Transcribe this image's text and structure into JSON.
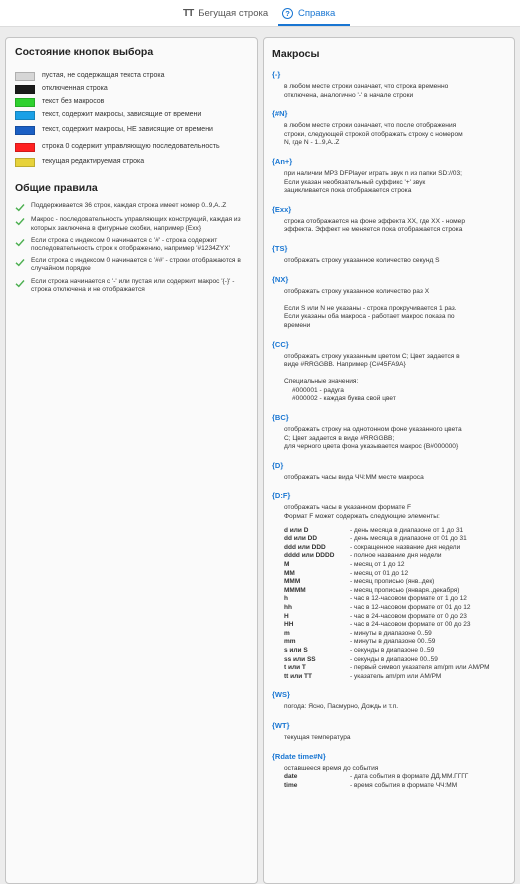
{
  "tabs": [
    {
      "label": "Бегущая строка",
      "icon": "text-format-icon",
      "icon_glyph": "TT",
      "active": false
    },
    {
      "label": "Справка",
      "icon": "help-circle-icon",
      "icon_glyph": "?",
      "active": true
    }
  ],
  "colors": {
    "accent": "#1976d2",
    "check": "#4caf50"
  },
  "left": {
    "title": "Состояние кнопок выбора",
    "legend": [
      {
        "color": "#d6d6d6",
        "text": "пустая, не содержащая текста строка"
      },
      {
        "color": "#1b1b1b",
        "text": "отключенная строка"
      },
      {
        "color": "#2fd12f",
        "text": "текст без макросов"
      },
      {
        "color": "#1aa0e6",
        "text": "текст, содержит макросы, зависящие от времени"
      },
      {
        "color": "#1a5fc4",
        "text": "текст, содержит макросы, НЕ зависящие от времени"
      },
      {
        "color": "#ff2020",
        "text": "строка 0 содержит управляющую последовательность"
      },
      {
        "color": "#e7d23a",
        "text": "текущая редактируемая строка"
      }
    ],
    "rules_title": "Общие правила",
    "rules": [
      "Поддерживается 36 строк, каждая строка имеет номер 0..9,A..Z",
      "Макрос - последовательность управляющих конструкций, каждая из которых заключена в фигурные скобки, например {Exx}",
      "Если строка с индексом 0 начинается с '#' - строка содержит последовательность строк к отображению, например '#1234ZYX'",
      "Если строка с индексом 0 начинается с '##' - строки отображаются в случайном порядке",
      "Если строка начинается с '-' или пустая или содержит макрос '{-}' - строка отключена и не отображается"
    ]
  },
  "right": {
    "title": "Макросы",
    "macros": [
      {
        "code": "{-}",
        "lines": [
          "в любом месте строки означает, что строка временно",
          "отключена, аналогично '-' в начале строки"
        ]
      },
      {
        "code": "{#N}",
        "lines": [
          "в любом месте строки означает, что после отображения",
          "строки, следующей строкой отображать строку с номером",
          "N, где N - 1..9,A..Z"
        ]
      },
      {
        "code": "{An+}",
        "lines": [
          "при наличии MP3 DFPlayer играть звук n из папки SD://03;",
          "Если указан необязательный суффикс '+' звук",
          "зацикливается пока отображается строка"
        ]
      },
      {
        "code": "{Exx}",
        "lines": [
          "строка отображается на фоне эффекта XX, где XX - номер",
          "эффекта. Эффект не меняется пока отображается строка"
        ]
      },
      {
        "code": "{TS}",
        "lines": [
          "отображать строку указанное количество секунд S"
        ]
      },
      {
        "code": "{NX}",
        "lines": [
          "отображать строку указанное количество раз X",
          "",
          "Если S или N не указаны - строка прокручивается 1 раз.",
          "Если указаны оба макроса - работает макрос показа по",
          "времени"
        ]
      },
      {
        "code": "{CC}",
        "lines": [
          "отображать строку указанным цветом C; Цвет задается в",
          "виде #RRGGBB. Например {C#45FA9A}",
          "",
          "Специальные значения:",
          "  #000001 - радуга",
          "  #000002 - каждая буква свой цвет"
        ]
      },
      {
        "code": "{BC}",
        "lines": [
          "отображать строку на однотонном фоне указанного цвета",
          "C; Цвет задается в виде #RRGGBB;",
          "для черного цвета фона указывается макрос {B#000000}"
        ]
      },
      {
        "code": "{D}",
        "lines": [
          "отображать часы вида ЧЧ:ММ месте макроса"
        ]
      },
      {
        "code": "{D:F}",
        "lines": [
          "отображать часы в указанном формате F",
          "Формат F может содержать следующие элементы:"
        ]
      }
    ],
    "formats": [
      {
        "key": "d или D",
        "val": "- день месяца в диапазоне от 1 до 31"
      },
      {
        "key": "dd или DD",
        "val": "- день месяца в диапазоне от 01 до 31"
      },
      {
        "key": "ddd или DDD",
        "val": "- сокращенное название дня недели"
      },
      {
        "key": "dddd или DDDD",
        "val": "- полное название дня недели"
      },
      {
        "key": "M",
        "val": "- месяц от 1 до 12"
      },
      {
        "key": "MM",
        "val": "- месяц от 01 до 12"
      },
      {
        "key": "MMM",
        "val": "- месяц прописью (янв..дек)"
      },
      {
        "key": "MMMM",
        "val": "- месяц прописью (января..декабря)"
      },
      {
        "key": "h",
        "val": "- час в 12-часовом формате от 1 до 12"
      },
      {
        "key": "hh",
        "val": "- час в 12-часовом формате от 01 до 12"
      },
      {
        "key": "H",
        "val": "- час в 24-часовом формате от 0 до 23"
      },
      {
        "key": "HH",
        "val": "- час в 24-часовом формате от 00 до 23"
      },
      {
        "key": "m",
        "val": "- минуты в диапазоне 0..59"
      },
      {
        "key": "mm",
        "val": "- минуты в диапазоне 00..59"
      },
      {
        "key": "s или S",
        "val": "- секунды в диапазоне 0..59"
      },
      {
        "key": "ss или SS",
        "val": "- секунды в диапазоне 00..59"
      },
      {
        "key": "t или T",
        "val": "- первый символ указателя am/pm или AM/PM"
      },
      {
        "key": "tt или TT",
        "val": "- указатель am/pm или AM/PM"
      }
    ],
    "macros_after": [
      {
        "code": "{WS}",
        "lines": [
          "погода: Ясно, Пасмурно, Дождь и т.п."
        ]
      },
      {
        "code": "{WT}",
        "lines": [
          "текущая температура"
        ]
      },
      {
        "code": "{Rdate time#N}",
        "lines": [
          "оставшееся время до события"
        ]
      }
    ],
    "rdate_rows": [
      {
        "key": "date",
        "val": "- дата события в формате ДД.ММ.ГГГГ"
      },
      {
        "key": "time",
        "val": "- время события в формате ЧЧ:ММ"
      }
    ]
  }
}
